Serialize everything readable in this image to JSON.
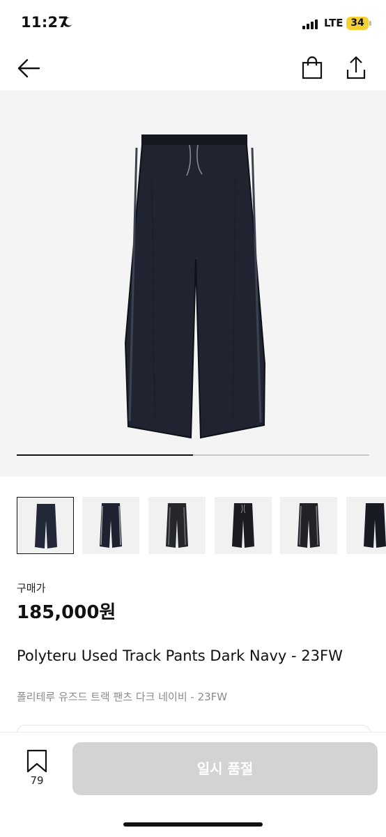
{
  "status_bar": {
    "time": "11:27",
    "network": "LTE",
    "battery": "34"
  },
  "nav": {
    "back_icon": "arrow-left-icon",
    "bag_icon": "shopping-bag-icon",
    "share_icon": "share-icon"
  },
  "gallery": {
    "image_count": 6,
    "current_index": 1,
    "progress": 0.5
  },
  "product": {
    "price_label": "구매가",
    "price": "185,000원",
    "title": "Polyteru Used Track Pants Dark Navy - 23FW",
    "subtitle": "폴리테루 유즈드 트랙 팬츠 다크 네이비 - 23FW"
  },
  "bottom_bar": {
    "bookmark_count": "79",
    "buy_button_label": "일시 품절"
  },
  "colors": {
    "sold_out_button": "#d3d3d3",
    "pants": "#1f2430",
    "pants_edge": "#0e1118"
  }
}
